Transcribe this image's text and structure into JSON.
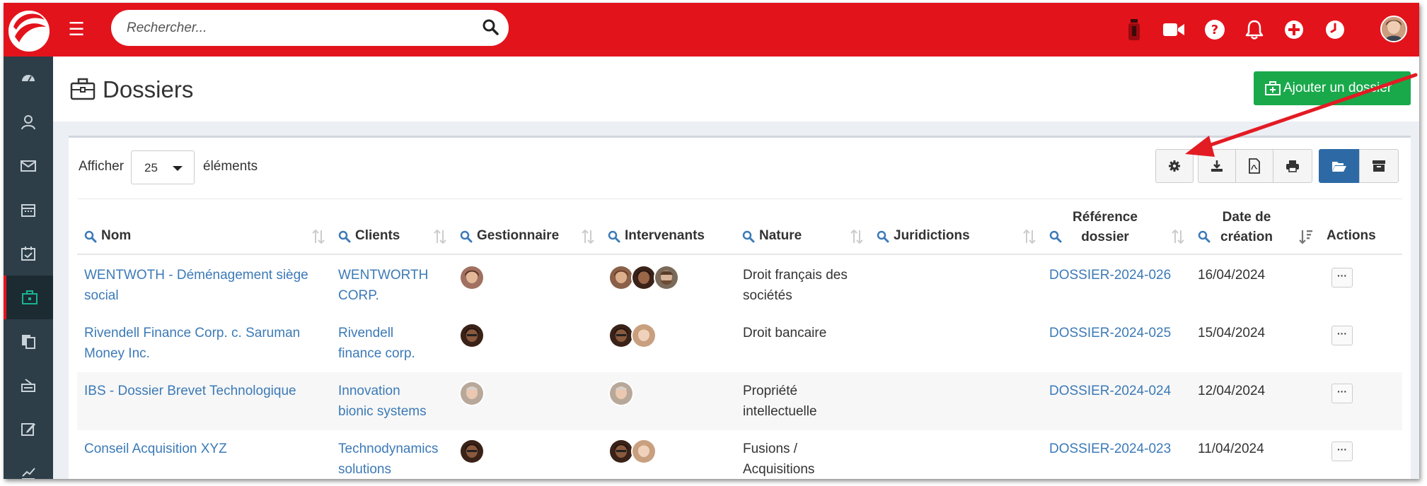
{
  "topbar": {
    "search_placeholder": "Rechercher...",
    "icons": [
      "timer-icon",
      "video-icon",
      "help-icon",
      "bell-icon",
      "add-circle-icon",
      "clock-icon"
    ]
  },
  "page": {
    "title": "Dossiers",
    "add_button_label": "Ajouter un dossier"
  },
  "listing": {
    "show_label": "Afficher",
    "page_size": "25",
    "elements_label": "éléments"
  },
  "table": {
    "columns": [
      {
        "label": "Nom"
      },
      {
        "label": "Clients"
      },
      {
        "label": "Gestionnaire"
      },
      {
        "label": "Intervenants"
      },
      {
        "label": "Nature"
      },
      {
        "label": "Juridictions"
      },
      {
        "label": "Référence dossier"
      },
      {
        "label": "Date de création"
      },
      {
        "label": "Actions"
      }
    ],
    "rows": [
      {
        "nom": "WENTWOTH - Déménagement siège social",
        "client": "WENTWORTH CORP.",
        "nature": "Droit français des sociétés",
        "juridiction": "",
        "reference": "DOSSIER-2024-026",
        "date": "16/04/2024",
        "action": "···"
      },
      {
        "nom": "Rivendell Finance Corp. c. Saruman Money Inc.",
        "client": "Rivendell finance corp.",
        "nature": "Droit bancaire",
        "juridiction": "",
        "reference": "DOSSIER-2024-025",
        "date": "15/04/2024",
        "action": "···"
      },
      {
        "nom": "IBS - Dossier Brevet Technologique",
        "client": "Innovation bionic systems",
        "nature": "Propriété intellectuelle",
        "juridiction": "",
        "reference": "DOSSIER-2024-024",
        "date": "12/04/2024",
        "action": "···"
      },
      {
        "nom": "Conseil Acquisition XYZ",
        "client": "Technodynamics solutions",
        "nature": "Fusions / Acquisitions",
        "juridiction": "",
        "reference": "DOSSIER-2024-023",
        "date": "11/04/2024",
        "action": "···"
      }
    ]
  },
  "colors": {
    "brand_red": "#e3131c",
    "sidebar": "#2e3e48",
    "link": "#3c7ab7",
    "success": "#19a94b",
    "primary": "#2d6aa5"
  }
}
